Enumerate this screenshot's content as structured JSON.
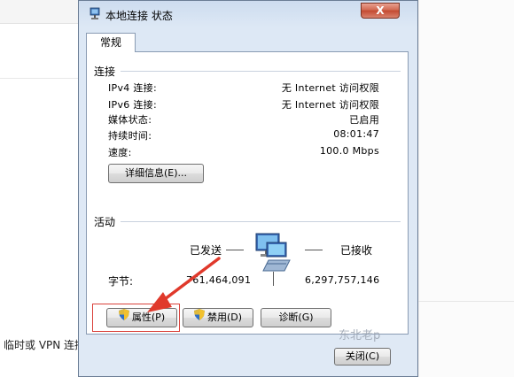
{
  "background": {
    "partial_text": "临时或 VPN 连接"
  },
  "dialog": {
    "title": "本地连接 状态",
    "close_label": "X",
    "tabs": [
      {
        "label": "常规"
      }
    ],
    "connection": {
      "title": "连接",
      "rows": [
        {
          "label": "IPv4 连接:",
          "value": "无 Internet 访问权限"
        },
        {
          "label": "IPv6 连接:",
          "value": "无 Internet 访问权限"
        },
        {
          "label": "媒体状态:",
          "value": "已启用"
        },
        {
          "label": "持续时间:",
          "value": "08:01:47"
        },
        {
          "label": "速度:",
          "value": "100.0 Mbps"
        }
      ],
      "details_button": "详细信息(E)..."
    },
    "activity": {
      "title": "活动",
      "sent_label": "已发送",
      "received_label": "已接收",
      "bytes_label": "字节:",
      "bytes_sent": "761,464,091",
      "bytes_received": "6,297,757,146"
    },
    "buttons": {
      "properties": "属性(P)",
      "disable": "禁用(D)",
      "diagnose": "诊断(G)",
      "close": "关闭(C)"
    }
  },
  "watermark": "东北老p",
  "colors": {
    "highlight": "#d9413a",
    "arrow": "#e0392b",
    "close_button": "#c44a31"
  }
}
